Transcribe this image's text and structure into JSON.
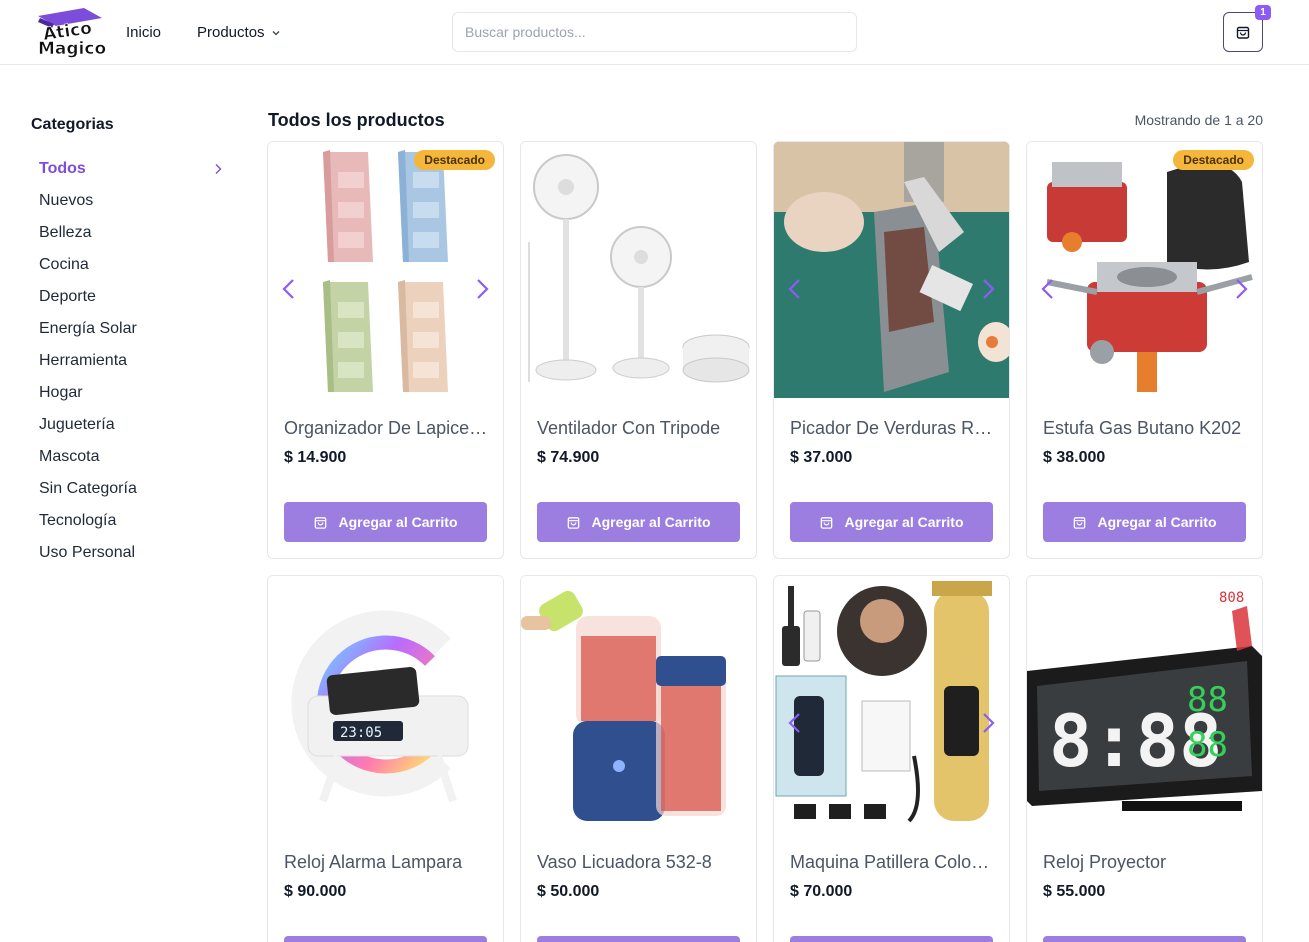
{
  "header": {
    "logo_text": "Atico Magico",
    "nav": [
      {
        "label": "Inicio"
      },
      {
        "label": "Productos"
      }
    ],
    "search_placeholder": "Buscar productos...",
    "cart_count": "1"
  },
  "sidebar": {
    "title": "Categorias",
    "items": [
      {
        "label": "Todos",
        "active": true
      },
      {
        "label": "Nuevos"
      },
      {
        "label": "Belleza"
      },
      {
        "label": "Cocina"
      },
      {
        "label": "Deporte"
      },
      {
        "label": "Energía Solar"
      },
      {
        "label": "Herramienta"
      },
      {
        "label": "Hogar"
      },
      {
        "label": "Juguetería"
      },
      {
        "label": "Mascota"
      },
      {
        "label": "Sin Categoría"
      },
      {
        "label": "Tecnología"
      },
      {
        "label": "Uso Personal"
      }
    ]
  },
  "main": {
    "title": "Todos los productos",
    "showing": "Mostrando de 1 a 20",
    "add_label": "Agregar al Carrito",
    "featured_label": "Destacado",
    "products": [
      {
        "name": "Organizador De Lapiceros",
        "price": "$ 14.900",
        "featured": true,
        "image": "pen-organizer"
      },
      {
        "name": "Ventilador Con Tripode",
        "price": "$ 74.900",
        "featured": false,
        "image": "folding-fan"
      },
      {
        "name": "Picador De Verduras Rapido",
        "price": "$ 37.000",
        "featured": false,
        "image": "vegetable-chopper"
      },
      {
        "name": "Estufa Gas Butano K202",
        "price": "$ 38.000",
        "featured": true,
        "image": "butane-stove"
      },
      {
        "name": "Reloj Alarma Lampara",
        "price": "$ 90.000",
        "featured": false,
        "image": "alarm-lamp"
      },
      {
        "name": "Vaso Licuadora 532-8",
        "price": "$ 50.000",
        "featured": false,
        "image": "blender-cup"
      },
      {
        "name": "Maquina Patillera Color Dorado",
        "price": "$ 70.000",
        "featured": false,
        "image": "hair-trimmer"
      },
      {
        "name": "Reloj Proyector",
        "price": "$ 55.000",
        "featured": false,
        "image": "projector-clock"
      }
    ]
  },
  "colors": {
    "accent": "#7c4ddb",
    "button": "#9b7ee0",
    "badge": "#f5b73b"
  }
}
